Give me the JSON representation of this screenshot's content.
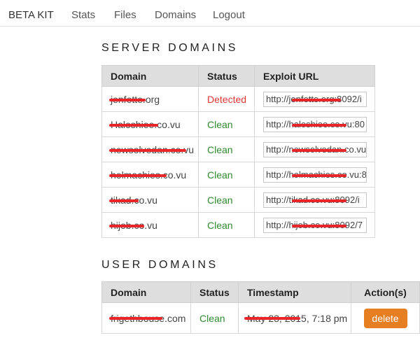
{
  "nav": {
    "brand": "BETA KIT",
    "links": [
      "Stats",
      "Files",
      "Domains",
      "Logout"
    ]
  },
  "server_domains": {
    "title": "SERVER DOMAINS",
    "headers": [
      "Domain",
      "Status",
      "Exploit URL"
    ],
    "rows": [
      {
        "domain": "jenfette.org",
        "status": "Detected",
        "url": "http://jenfette.org:8092/i"
      },
      {
        "domain": "Haloshiee.co.vu",
        "status": "Clean",
        "url": "http://haloshiee.co.vu:80"
      },
      {
        "domain": "newsolvedan.co.vu",
        "status": "Clean",
        "url": "http://newsolvedan.co.vu"
      },
      {
        "domain": "holmachies.co.vu",
        "status": "Clean",
        "url": "http://holmachies.co.vu:8"
      },
      {
        "domain": "tikad.co.vu",
        "status": "Clean",
        "url": "http://tikad.co.vu:8092/i"
      },
      {
        "domain": "hijob.co.vu",
        "status": "Clean",
        "url": "http://hijob.co.vu:8092/7"
      }
    ]
  },
  "user_domains": {
    "title": "USER DOMAINS",
    "headers": [
      "Domain",
      "Status",
      "Timestamp",
      "Action(s)"
    ],
    "rows": [
      {
        "domain": "frigethbouse.com",
        "status": "Clean",
        "timestamp": "May 23, 2015, 7:18 pm",
        "action": "delete"
      }
    ]
  },
  "colors": {
    "clean": "#2e8b2e",
    "detected": "#e33434",
    "delete_button": "#e67e22",
    "redaction": "#e8262a"
  }
}
